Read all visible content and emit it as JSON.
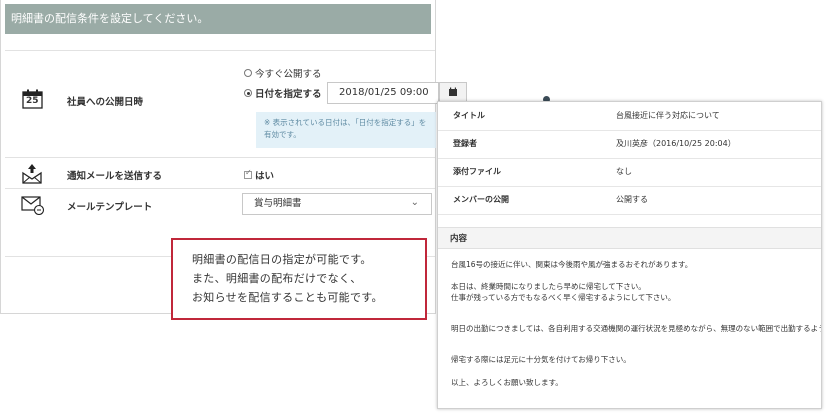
{
  "header": {
    "title": "明細書の配信条件を設定してください。"
  },
  "form": {
    "publish": {
      "label": "社員への公開日時",
      "calendar_day": "25",
      "option_now": "今すぐ公開する",
      "option_date": "日付を指定する",
      "selected": "option_date",
      "date_value": "2018/01/25 09:00",
      "note_line1": "※ 表示されている日付は、「日付を指定する」を",
      "note_line2": "有効です。"
    },
    "notify": {
      "label": "通知メールを送信する",
      "checkbox_label": "はい",
      "checked": true
    },
    "template": {
      "label": "メールテンプレート",
      "selected": "賞与明細書"
    }
  },
  "callout": {
    "line1": "明細書の配信日の指定が可能です。",
    "line2": "また、明細書の配布だけでなく、",
    "line3": "お知らせを配信することも可能です。"
  },
  "detail": {
    "rows": [
      {
        "key": "タイトル",
        "value": "台風接近に伴う対応について"
      },
      {
        "key": "登録者",
        "value": "及川英彦（2016/10/25 20:04）"
      },
      {
        "key": "添付ファイル",
        "value": "なし"
      },
      {
        "key": "メンバーの公開",
        "value": "公開する"
      }
    ],
    "content_label": "内容",
    "body": [
      "台風16号の接近に伴い、関東は今後雨や風が強まるおそれがあります。",
      "本日は、終業時間になりましたら早めに帰宅して下さい。",
      "仕事が残っている方でもなるべく早く帰宅するようにして下さい。",
      "明日の出勤につきましては、各自利用する交通機関の運行状況を見極めながら、無理のない範囲で出勤するよう",
      "帰宅する際には足元に十分気を付けてお帰り下さい。",
      "以上、よろしくお願い致します。"
    ]
  },
  "colors": {
    "header_bg": "#9aaba6",
    "callout_border": "#c0273a",
    "note_bg": "#e3f1f8"
  }
}
